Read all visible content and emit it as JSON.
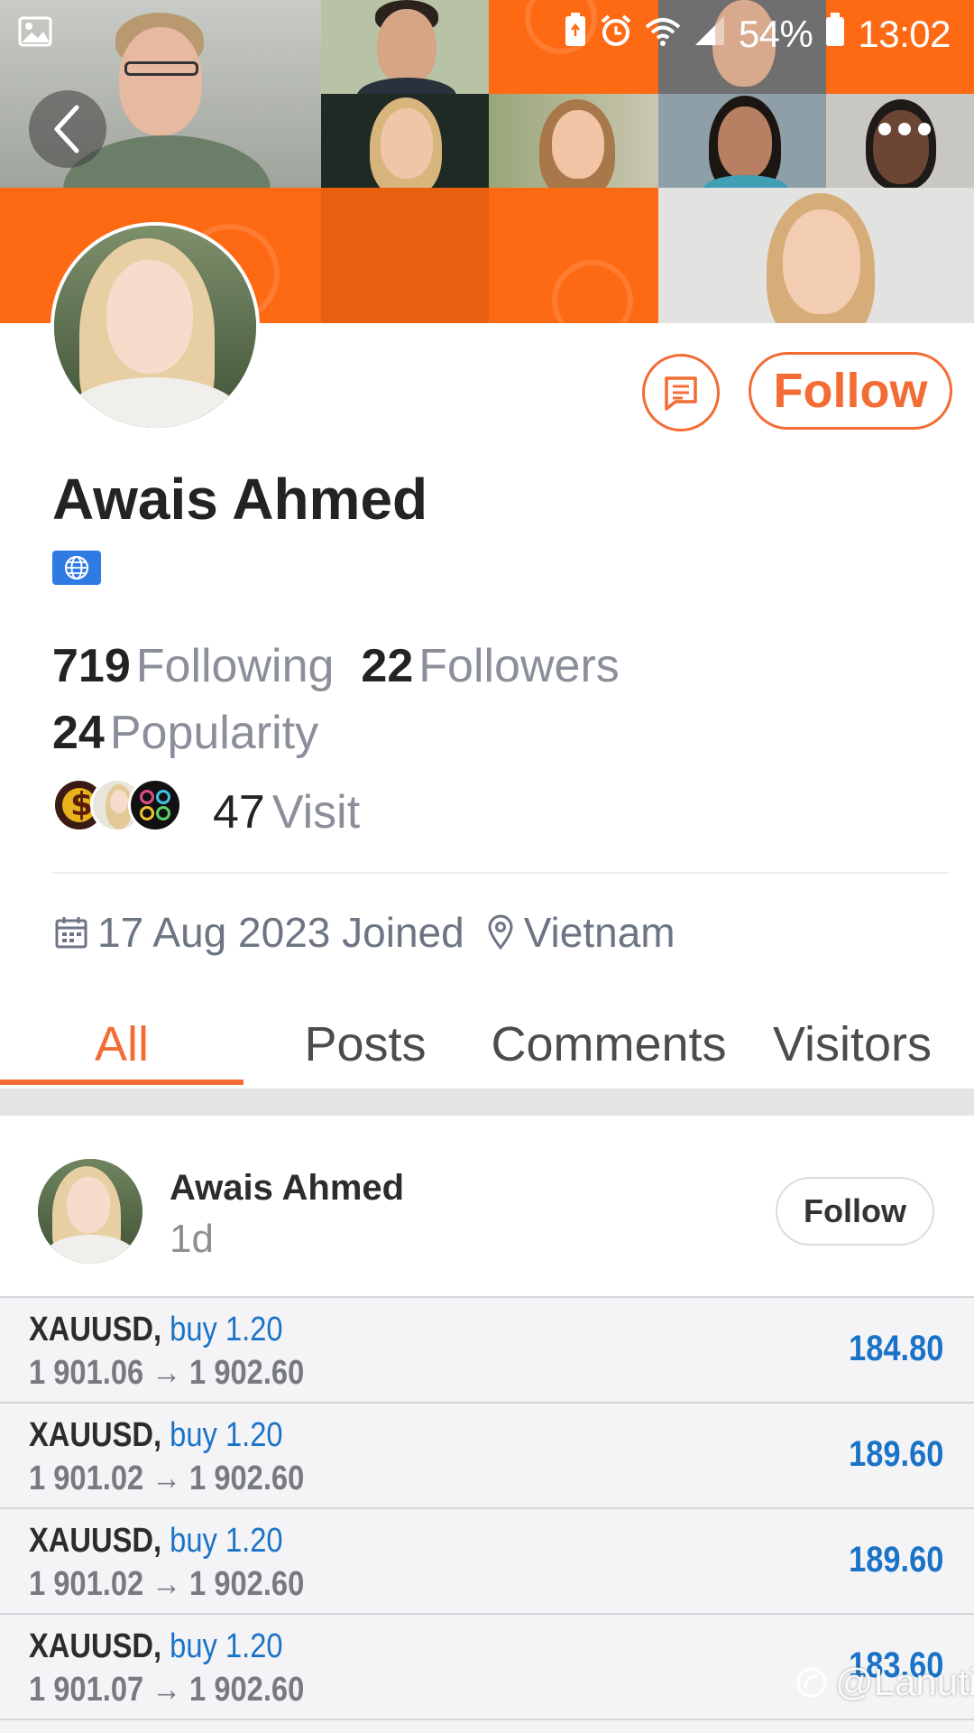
{
  "status_bar": {
    "battery_percent": "54%",
    "time": "13:02"
  },
  "header": {
    "back_icon": "chevron-left-icon",
    "more_icon": "more-horizontal-icon"
  },
  "profile": {
    "name": "Awais Ahmed",
    "badge_icon": "globe-icon",
    "follow_label": "Follow",
    "message_icon": "message-icon",
    "stats": {
      "following_count": "719",
      "following_label": "Following",
      "followers_count": "22",
      "followers_label": "Followers",
      "popularity_count": "24",
      "popularity_label": "Popularity",
      "visit_count": "47",
      "visit_label": "Visit"
    },
    "joined": "17 Aug 2023 Joined",
    "location": "Vietnam"
  },
  "tabs": [
    {
      "label": "All",
      "active": true
    },
    {
      "label": "Posts",
      "active": false
    },
    {
      "label": "Comments",
      "active": false
    },
    {
      "label": "Visitors",
      "active": false
    }
  ],
  "post": {
    "author": "Awais Ahmed",
    "time": "1d",
    "follow_label": "Follow",
    "trades": [
      {
        "symbol": "XAUUSD,",
        "action": "buy 1.20",
        "open": "1 901.06",
        "close": "1 902.60",
        "profit": "184.80"
      },
      {
        "symbol": "XAUUSD,",
        "action": "buy 1.20",
        "open": "1 901.02",
        "close": "1 902.60",
        "profit": "189.60"
      },
      {
        "symbol": "XAUUSD,",
        "action": "buy 1.20",
        "open": "1 901.02",
        "close": "1 902.60",
        "profit": "189.60"
      },
      {
        "symbol": "XAUUSD,",
        "action": "buy 1.20",
        "open": "1 901.07",
        "close": "1 902.60",
        "profit": "183.60"
      }
    ]
  },
  "watermark": "@Lanuti",
  "colors": {
    "accent": "#f36c33",
    "header_orange": "#fe6a14",
    "profit_blue": "#1a73c7"
  }
}
